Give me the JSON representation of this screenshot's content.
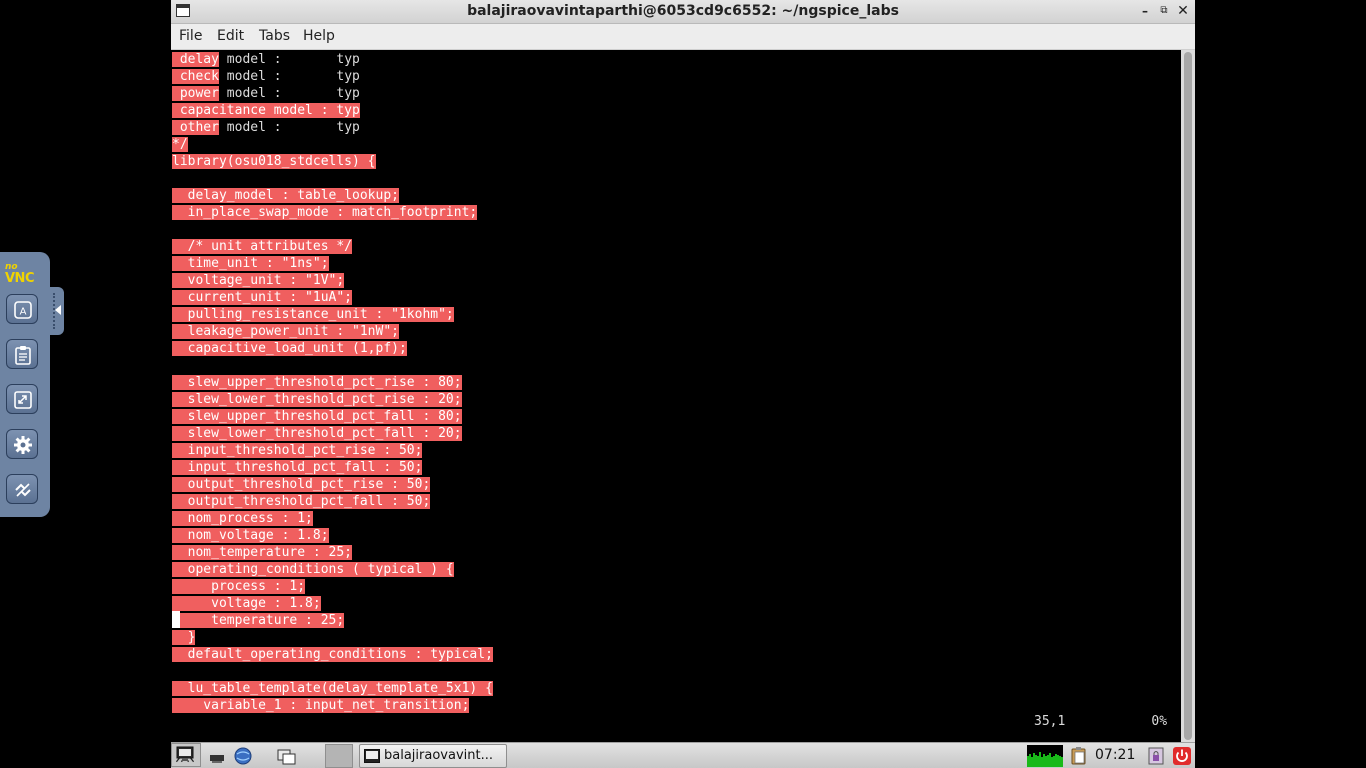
{
  "window": {
    "title": "balajiraovavintaparthi@6053cd9c6552: ~/ngspice_labs",
    "controls": {
      "minimize": "–",
      "maximize": "⧉",
      "close": "✕"
    }
  },
  "menu": [
    "File",
    "Edit",
    "Tabs",
    "Help"
  ],
  "terminal": {
    "lines": [
      {
        "sel": " delay",
        "plain": " model :       typ"
      },
      {
        "sel": " check",
        "plain": " model :       typ"
      },
      {
        "sel": " power",
        "plain": " model :       typ"
      },
      {
        "sel": " capacitance model : typ",
        "plain": ""
      },
      {
        "sel": " other",
        "plain": " model :       typ"
      },
      {
        "sel": "*/",
        "plain": ""
      },
      {
        "sel": "library(osu018_stdcells) {",
        "plain": ""
      },
      {
        "sel": "",
        "plain": ""
      },
      {
        "sel": "  delay_model : table_lookup;",
        "plain": ""
      },
      {
        "sel": "  in_place_swap_mode : match_footprint;",
        "plain": ""
      },
      {
        "sel": "",
        "plain": ""
      },
      {
        "sel": "  /* unit attributes */",
        "plain": ""
      },
      {
        "sel": "  time_unit : \"1ns\";",
        "plain": ""
      },
      {
        "sel": "  voltage_unit : \"1V\";",
        "plain": ""
      },
      {
        "sel": "  current_unit : \"1uA\";",
        "plain": ""
      },
      {
        "sel": "  pulling_resistance_unit : \"1kohm\";",
        "plain": ""
      },
      {
        "sel": "  leakage_power_unit : \"1nW\";",
        "plain": ""
      },
      {
        "sel": "  capacitive_load_unit (1,pf);",
        "plain": ""
      },
      {
        "sel": "",
        "plain": ""
      },
      {
        "sel": "  slew_upper_threshold_pct_rise : 80;",
        "plain": ""
      },
      {
        "sel": "  slew_lower_threshold_pct_rise : 20;",
        "plain": ""
      },
      {
        "sel": "  slew_upper_threshold_pct_fall : 80;",
        "plain": ""
      },
      {
        "sel": "  slew_lower_threshold_pct_fall : 20;",
        "plain": ""
      },
      {
        "sel": "  input_threshold_pct_rise : 50;",
        "plain": ""
      },
      {
        "sel": "  input_threshold_pct_fall : 50;",
        "plain": ""
      },
      {
        "sel": "  output_threshold_pct_rise : 50;",
        "plain": ""
      },
      {
        "sel": "  output_threshold_pct_fall : 50;",
        "plain": ""
      },
      {
        "sel": "  nom_process : 1;",
        "plain": ""
      },
      {
        "sel": "  nom_voltage : 1.8;",
        "plain": ""
      },
      {
        "sel": "  nom_temperature : 25;",
        "plain": ""
      },
      {
        "sel": "  operating_conditions ( typical ) {",
        "plain": ""
      },
      {
        "sel": "     process : 1;",
        "plain": ""
      },
      {
        "sel": "     voltage : 1.8;",
        "plain": ""
      },
      {
        "sel": "     temperature : 25;",
        "plain": ""
      },
      {
        "sel": "  }",
        "plain": ""
      },
      {
        "sel": "  default_operating_conditions : typical;",
        "plain": ""
      },
      {
        "sel": "",
        "plain": ""
      },
      {
        "sel": "  lu_table_template(delay_template_5x1) {",
        "plain": ""
      },
      {
        "sel": "    variable_1 : input_net_transition;",
        "plain": ""
      }
    ],
    "ruler": "35,1           0%",
    "colors": {
      "selection": "#f05f5f",
      "background": "#000000"
    }
  },
  "novnc": {
    "logo_no": "no",
    "logo_vnc": "VNC",
    "buttons": [
      "keyboard-icon",
      "clipboard-icon",
      "fullscreen-icon",
      "settings-icon",
      "disconnect-icon"
    ]
  },
  "taskbar": {
    "task_label": "balajiraovavint...",
    "clock": "07:21"
  }
}
